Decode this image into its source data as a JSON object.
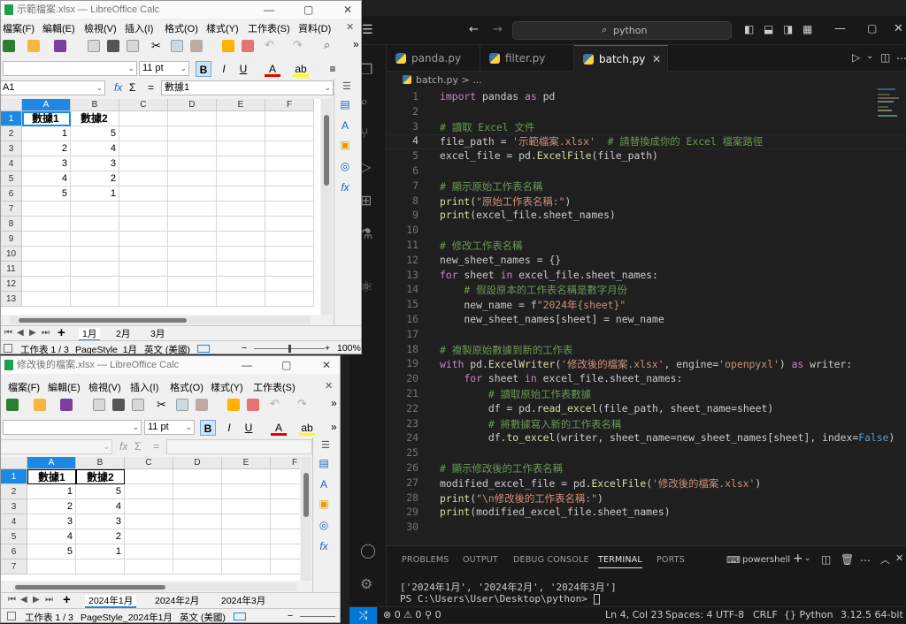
{
  "vscode": {
    "search": "python",
    "tabs": [
      {
        "label": "panda.py"
      },
      {
        "label": "filter.py"
      },
      {
        "label": "batch.py"
      }
    ],
    "breadcrumb": "batch.py > ...",
    "code_lines": [
      "import pandas as pd",
      "",
      "# 讀取 Excel 文件",
      "file_path = '示範檔案.xlsx'  # 請替換成你的 Excel 檔案路徑",
      "excel_file = pd.ExcelFile(file_path)",
      "",
      "# 顯示原始工作表名稱",
      "print(\"原始工作表名稱:\")",
      "print(excel_file.sheet_names)",
      "",
      "# 修改工作表名稱",
      "new_sheet_names = {}",
      "for sheet in excel_file.sheet_names:",
      "    # 假設原本的工作表名稱是數字月份",
      "    new_name = f\"2024年{sheet}\"",
      "    new_sheet_names[sheet] = new_name",
      "",
      "# 複製原始數據到新的工作表",
      "with pd.ExcelWriter('修改後的檔案.xlsx', engine='openpyxl') as writer:",
      "    for sheet in excel_file.sheet_names:",
      "        # 讀取原始工作表數據",
      "        df = pd.read_excel(file_path, sheet_name=sheet)",
      "        # 將數據寫入新的工作表名稱",
      "        df.to_excel(writer, sheet_name=new_sheet_names[sheet], index=False)",
      "",
      "# 顯示修改後的工作表名稱",
      "modified_excel_file = pd.ExcelFile('修改後的檔案.xlsx')",
      "print(\"\\n修改後的工作表名稱:\")",
      "print(modified_excel_file.sheet_names)",
      ""
    ],
    "panel_tabs": [
      "PROBLEMS",
      "OUTPUT",
      "DEBUG CONSOLE",
      "TERMINAL",
      "PORTS"
    ],
    "terminal_shell": "powershell",
    "terminal_lines": [
      "['2024年1月', '2024年2月', '2024年3月']",
      "PS C:\\Users\\User\\Desktop\\python> "
    ],
    "status": {
      "errors": "0",
      "warnings": "0",
      "ports": "0",
      "position": "Ln 4, Col 23",
      "spaces": "Spaces: 4",
      "encoding": "UTF-8",
      "eol": "CRLF",
      "language": "Python",
      "interpreter": "3.12.5 64-bit"
    }
  },
  "calc1": {
    "title": "示範檔案.xlsx — LibreOffice Calc",
    "menu": [
      "檔案(F)",
      "編輯(E)",
      "檢視(V)",
      "插入(I)",
      "格式(O)",
      "樣式(Y)",
      "工作表(S)",
      "資料(D)"
    ],
    "font_size": "11 pt",
    "name_box": "A1",
    "formula": "數據1",
    "columns": [
      "A",
      "B",
      "C",
      "D",
      "E",
      "F"
    ],
    "rows": [
      "1",
      "2",
      "3",
      "4",
      "5",
      "6",
      "7",
      "8",
      "9",
      "10",
      "11",
      "12",
      "13"
    ],
    "headers": [
      "數據1",
      "數據2"
    ],
    "data": [
      [
        "1",
        "5"
      ],
      [
        "2",
        "4"
      ],
      [
        "3",
        "3"
      ],
      [
        "4",
        "2"
      ],
      [
        "5",
        "1"
      ]
    ],
    "sheets": [
      "1月",
      "2月",
      "3月"
    ],
    "status": {
      "sheet": "工作表 1 / 3",
      "style": "PageStyle_1月",
      "lang": "英文 (美國)",
      "zoom": "100%"
    }
  },
  "calc2": {
    "title": "修改後的檔案.xlsx — LibreOffice Calc",
    "menu": [
      "檔案(F)",
      "編輯(E)",
      "檢視(V)",
      "插入(I)",
      "格式(O)",
      "樣式(Y)",
      "工作表(S)"
    ],
    "font_size": "11 pt",
    "columns": [
      "A",
      "B",
      "C",
      "D",
      "E",
      "F"
    ],
    "rows": [
      "1",
      "2",
      "3",
      "4",
      "5",
      "6",
      "7"
    ],
    "headers": [
      "數據1",
      "數據2"
    ],
    "data": [
      [
        "1",
        "5"
      ],
      [
        "2",
        "4"
      ],
      [
        "3",
        "3"
      ],
      [
        "4",
        "2"
      ],
      [
        "5",
        "1"
      ]
    ],
    "sheets": [
      "2024年1月",
      "2024年2月",
      "2024年3月"
    ],
    "status": {
      "sheet": "工作表 1 / 3",
      "style": "PageStyle_2024年1月",
      "lang": "英文 (美國)"
    }
  }
}
